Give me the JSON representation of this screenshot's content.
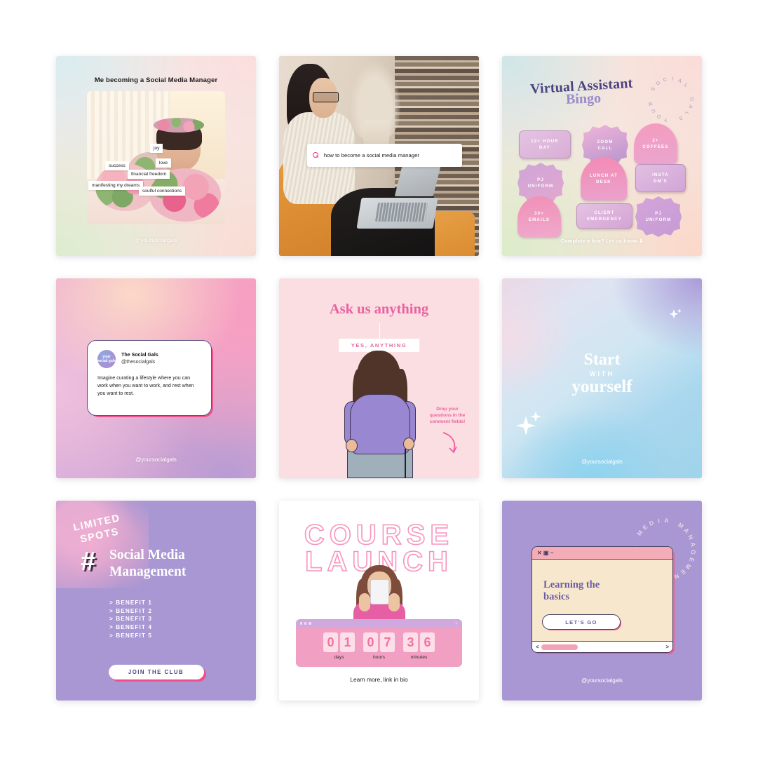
{
  "cards": {
    "meme": {
      "title": "Me becoming a Social Media Manager",
      "tags": [
        "joy",
        "love",
        "success",
        "financial freedom",
        "manifesting my dreams",
        "soulful connections"
      ],
      "handle": "@yoursocialgals"
    },
    "search": {
      "query": "how to become a social media manager",
      "icon": "search-icon"
    },
    "bingo": {
      "title_line1": "Virtual Assistant",
      "title_line2": "Bingo",
      "badge_ring_text": "YOUR SOCIAL GALS ",
      "tiles": [
        {
          "label": "12+ HOUR DAY",
          "shape": "rect"
        },
        {
          "label": "ZOOM CALL",
          "shape": "flower"
        },
        {
          "label": "2+ COFFEES",
          "shape": "arch"
        },
        {
          "label": "PJ UNIFORM",
          "shape": "flower"
        },
        {
          "label": "LUNCH AT DESK",
          "shape": "arch"
        },
        {
          "label": "INSTA DM'S",
          "shape": "rect"
        },
        {
          "label": "30+ EMAILS",
          "shape": "arch"
        },
        {
          "label": "CLIENT EMERGENCY",
          "shape": "rect"
        },
        {
          "label": "PJ UNIFORM",
          "shape": "flower"
        }
      ],
      "cta": "Complete a line? Let us know  ⬇"
    },
    "tweet": {
      "avatar_text": "your social gals",
      "name": "The Social Gals",
      "handle": "@thesocialgals",
      "body": "Imagine curating a lifestyle where you can work when you want to work, and rest when you want to rest.",
      "footer_handle": "@yoursocialgals"
    },
    "ask": {
      "headline": "Ask us anything",
      "ribbon": "YES, ANYTHING",
      "note": "Drop your questions in the comment fields!"
    },
    "start": {
      "line1": "Start",
      "line2": "WITH",
      "line3": "yourself",
      "handle": "@yoursocialgals"
    },
    "limited": {
      "badge_line1": "LIMITED",
      "badge_line2": "SPOTS",
      "hash": "#",
      "title": "Social Media Management",
      "benefits": [
        "> BENEFIT 1",
        "> BENEFIT 2",
        "> BENEFIT 3",
        "> BENEFIT 4",
        "> BENEFIT 5"
      ],
      "cta": "JOIN THE CLUB"
    },
    "course": {
      "title_line1": "COURSE",
      "title_line2": "LAUNCH",
      "countdown": [
        {
          "digits": [
            "0",
            "1"
          ],
          "label": "days"
        },
        {
          "digits": [
            "0",
            "7"
          ],
          "label": "hours"
        },
        {
          "digits": [
            "3",
            "6"
          ],
          "label": "minutes"
        }
      ],
      "footer": "Learn more, link in bio"
    },
    "basics": {
      "ring_text": "SOCIAL MEDIA MANAGEMENT ",
      "window_controls": "✕ ▣ −",
      "heading": "Learning the basics",
      "cta": "LET'S GO",
      "scroll_left": "<",
      "scroll_right": ">",
      "handle": "@yoursocialgals"
    }
  },
  "colors": {
    "pink": "#ef5f96",
    "purple": "#a897d2",
    "deep_purple": "#4c4480",
    "hot_pink": "#ea62a1",
    "cream": "#f7e8cd"
  }
}
